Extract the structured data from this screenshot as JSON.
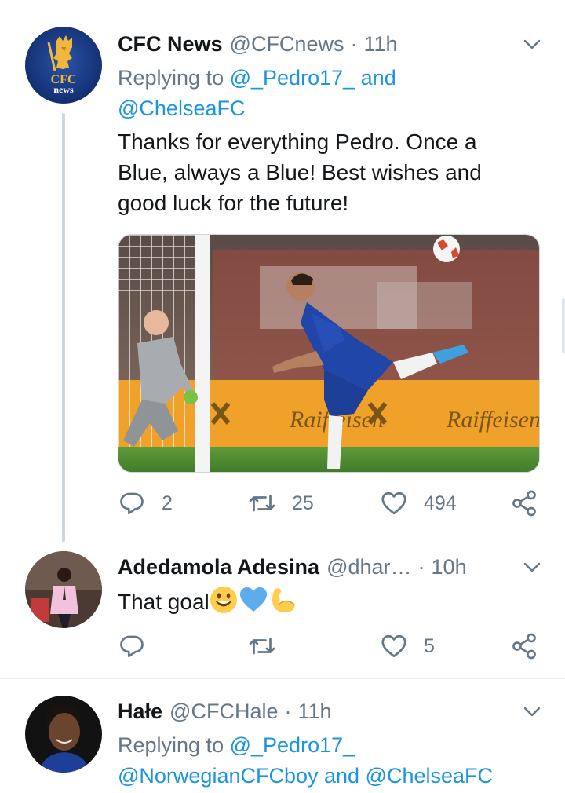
{
  "tweets": [
    {
      "name": "CFC News",
      "handle": "@CFCnews",
      "separator": "·",
      "time": "11h",
      "replying_prefix": "Replying to",
      "replying_users": "@_Pedro17_",
      "replying_and": "and",
      "replying_users_2": "@ChelseaFC",
      "text_line_1": "Thanks for everything Pedro. Once a",
      "text_line_2": "Blue, always a Blue! Best wishes and",
      "text_line_3": "good luck for the future!",
      "avatar_text_1": "CFC",
      "avatar_text_2": "news",
      "media_sign_1": "Raiffeisen",
      "media_sign_2": "Raiffeisen",
      "reply_count": "2",
      "retweet_count": "25",
      "like_count": "494"
    },
    {
      "name": "Adedamola Adesina",
      "handle": "@dhar…",
      "separator": "·",
      "time": "10h",
      "text": "That goal",
      "emojis": [
        "grinning-face-emoji",
        "blue-heart-emoji",
        "flexed-biceps-emoji"
      ],
      "reply_count": "",
      "retweet_count": "",
      "like_count": "5"
    },
    {
      "name": "Hałe",
      "handle": "@CFCHale",
      "separator": "·",
      "time": "11h",
      "replying_prefix": "Replying to",
      "replying_user_1": "@_Pedro17_",
      "replying_line_2": "@NorwegianCFCboy and @ChelseaFC"
    }
  ],
  "colors": {
    "link": "#1b95e0",
    "secondary_text": "#657786",
    "divider": "#e6ecf0",
    "thread_line": "#ccd6dd"
  },
  "icons": [
    "reply-icon",
    "retweet-icon",
    "like-icon",
    "share-icon",
    "chevron-down-icon"
  ]
}
